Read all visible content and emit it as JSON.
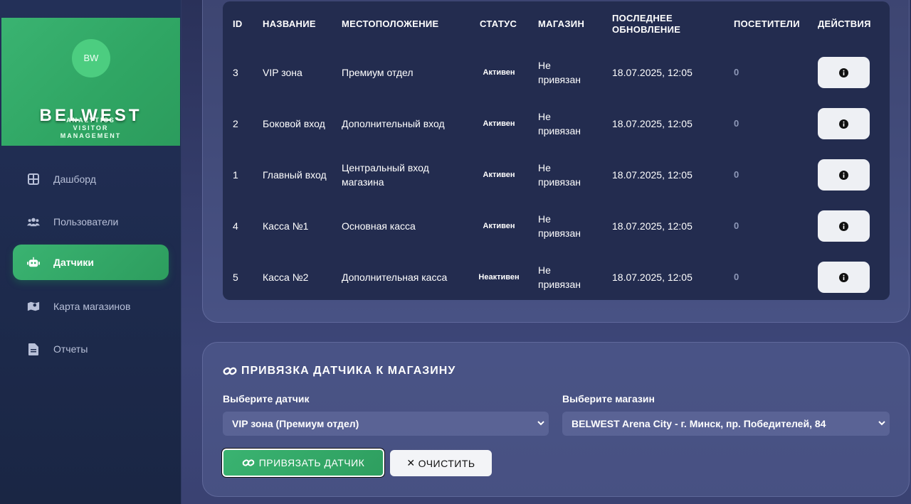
{
  "brand": {
    "logo": "BW",
    "name": "BELWEST",
    "sub_lines": [
      "ANALYTICS",
      "VISITOR",
      "MANAGEMENT"
    ]
  },
  "sidebar": {
    "items": [
      {
        "label": "Дашборд",
        "icon": "dashboard-icon"
      },
      {
        "label": "Пользователи",
        "icon": "users-icon"
      },
      {
        "label": "Датчики",
        "icon": "robot-icon",
        "active": true
      },
      {
        "label": "Карта магазинов",
        "icon": "map-icon"
      },
      {
        "label": "Отчеты",
        "icon": "file-icon"
      }
    ]
  },
  "table": {
    "headers": [
      "ID",
      "НАЗВАНИЕ",
      "МЕСТОПОЛОЖЕНИЕ",
      "СТАТУС",
      "МАГАЗИН",
      "ПОСЛЕДНЕЕ ОБНОВЛЕНИЕ",
      "ПОСЕТИТЕЛИ",
      "ДЕЙСТВИЯ"
    ],
    "rows": [
      {
        "id": "3",
        "name": "VIP зона",
        "location": "Премиум отдел",
        "status": "Активен",
        "store": "Не привязан",
        "updated": "18.07.2025, 12:05",
        "visitors": "0"
      },
      {
        "id": "2",
        "name": "Боковой вход",
        "location": "Дополнительный вход",
        "status": "Активен",
        "store": "Не привязан",
        "updated": "18.07.2025, 12:05",
        "visitors": "0"
      },
      {
        "id": "1",
        "name": "Главный вход",
        "location": "Центральный вход магазина",
        "status": "Активен",
        "store": "Не привязан",
        "updated": "18.07.2025, 12:05",
        "visitors": "0"
      },
      {
        "id": "4",
        "name": "Касса №1",
        "location": "Основная касса",
        "status": "Активен",
        "store": "Не привязан",
        "updated": "18.07.2025, 12:05",
        "visitors": "0"
      },
      {
        "id": "5",
        "name": "Касса №2",
        "location": "Дополнительная касса",
        "status": "Неактивен",
        "store": "Не привязан",
        "updated": "18.07.2025, 12:05",
        "visitors": "0"
      }
    ]
  },
  "bind": {
    "title": "ПРИВЯЗКА ДАТЧИКА К МАГАЗИНУ",
    "sensor_label": "Выберите датчик",
    "sensor_value": "VIP зона (Премиум отдел)",
    "store_label": "Выберите магазин",
    "store_value": "BELWEST Arena City - г. Минск, пр. Победителей, 84",
    "bind_button": "ПРИВЯЗАТЬ ДАТЧИК",
    "clear_button": "ОЧИСТИТЬ"
  },
  "colors": {
    "accent": "#3ab371",
    "sidebar_bg": "#1d2a4c",
    "table_bg": "#232c4f"
  }
}
